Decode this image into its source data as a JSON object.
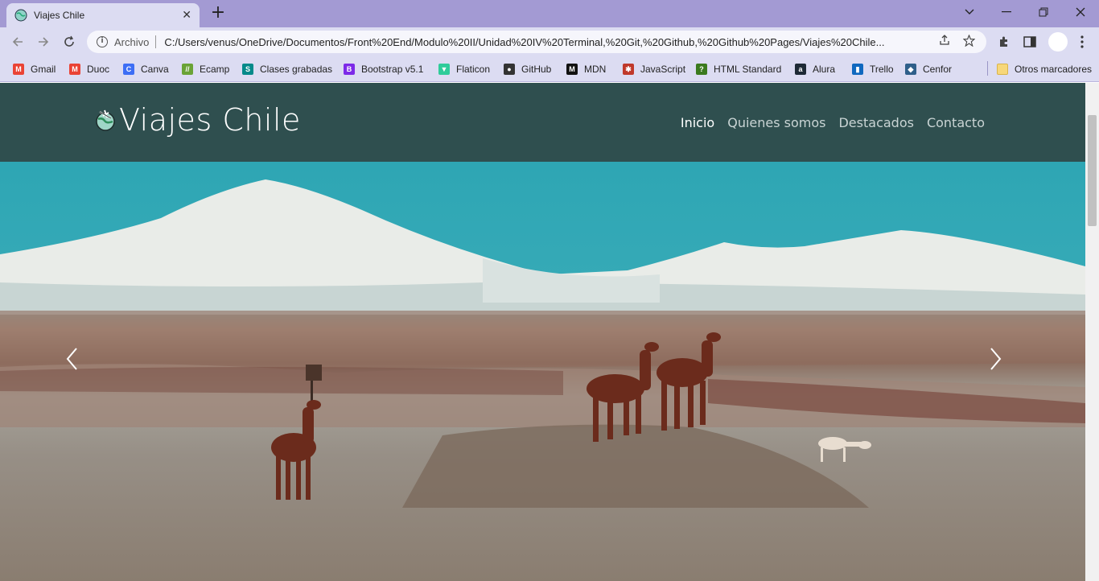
{
  "browser": {
    "tab": {
      "title": "Viajes Chile",
      "close": "✕"
    },
    "new_tab": "+",
    "omnibox": {
      "scheme": "Archivo",
      "url": "C:/Users/venus/OneDrive/Documentos/Front%20End/Modulo%20II/Unidad%20IV%20Terminal,%20Git,%20Github,%20Github%20Pages/Viajes%20Chile..."
    },
    "bookmarks": [
      {
        "label": "Gmail",
        "color": "#ea4335",
        "glyph": "M"
      },
      {
        "label": "Duoc",
        "color": "#ea4335",
        "glyph": "M"
      },
      {
        "label": "Canva",
        "color": "#3d6ef5",
        "glyph": "C"
      },
      {
        "label": "Ecamp",
        "color": "#6aa336",
        "glyph": "//"
      },
      {
        "label": "Clases grabadas",
        "color": "#058a8a",
        "glyph": "S"
      },
      {
        "label": "Bootstrap v5.1",
        "color": "#7d2ae8",
        "glyph": "B"
      },
      {
        "label": "Flaticon",
        "color": "#2fcc9a",
        "glyph": "▼"
      },
      {
        "label": "GitHub",
        "color": "#333333",
        "glyph": "●"
      },
      {
        "label": "MDN",
        "color": "#111111",
        "glyph": "M"
      },
      {
        "label": "JavaScript",
        "color": "#c0392b",
        "glyph": "✱"
      },
      {
        "label": "HTML Standard",
        "color": "#3b7a1e",
        "glyph": "?"
      },
      {
        "label": "Alura",
        "color": "#1e2a36",
        "glyph": "a"
      },
      {
        "label": "Trello",
        "color": "#1068bf",
        "glyph": "▮"
      },
      {
        "label": "Cenfor",
        "color": "#2f5f8a",
        "glyph": "◆"
      }
    ],
    "other_bookmarks": "Otros marcadores"
  },
  "site": {
    "brand": "Viajes Chile",
    "nav": [
      {
        "label": "Inicio",
        "active": true
      },
      {
        "label": "Quienes somos",
        "active": false
      },
      {
        "label": "Destacados",
        "active": false
      },
      {
        "label": "Contacto",
        "active": false
      }
    ],
    "colors": {
      "navbar": "#2f4f4f",
      "sky": "#2ea6b4"
    }
  }
}
